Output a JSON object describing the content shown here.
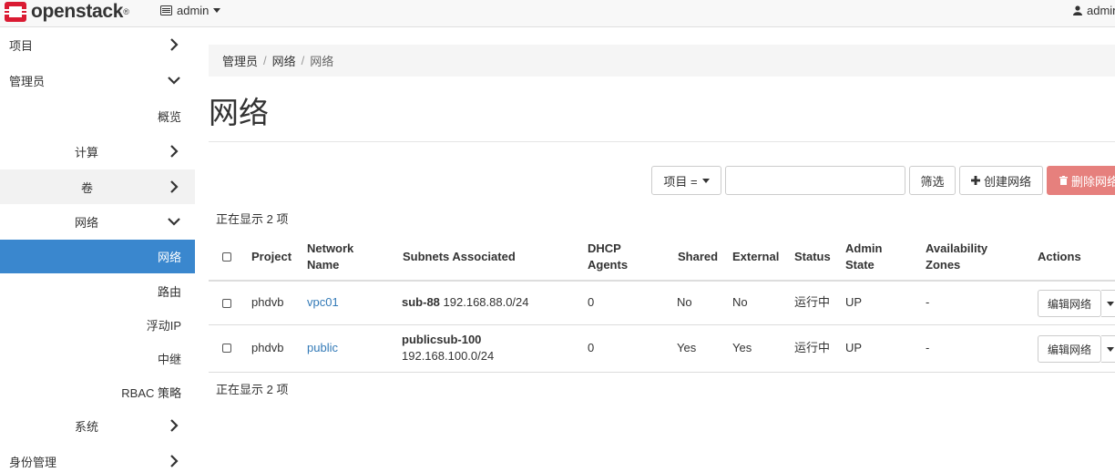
{
  "navbar": {
    "logo_text": "openstack",
    "logo_mark": "®",
    "project_label": "admin",
    "user_label": "admin"
  },
  "sidebar": {
    "items": [
      {
        "label": "项目"
      },
      {
        "label": "管理员"
      },
      {
        "label": "概览"
      },
      {
        "label": "计算"
      },
      {
        "label": "卷"
      },
      {
        "label": "网络"
      },
      {
        "label": "网络"
      },
      {
        "label": "路由"
      },
      {
        "label": "浮动IP"
      },
      {
        "label": "中继"
      },
      {
        "label": "RBAC 策略"
      },
      {
        "label": "系统"
      },
      {
        "label": "身份管理"
      }
    ]
  },
  "breadcrumb": [
    "管理员",
    "网络",
    "网络"
  ],
  "page_title": "网络",
  "toolbar": {
    "filter_field": "项目 =",
    "filter_value": "",
    "filter_button": "筛选",
    "create_button": "创建网络",
    "delete_button": "删除网络"
  },
  "count_top": "正在显示 2 项",
  "count_bottom": "正在显示 2 项",
  "table": {
    "headers": {
      "project": "Project",
      "network_name_1": "Network",
      "network_name_2": "Name",
      "subnets": "Subnets Associated",
      "dhcp_1": "DHCP",
      "dhcp_2": "Agents",
      "shared": "Shared",
      "external": "External",
      "status": "Status",
      "admin_1": "Admin",
      "admin_2": "State",
      "zones_1": "Availability",
      "zones_2": "Zones",
      "actions": "Actions"
    },
    "rows": [
      {
        "project": "phdvb",
        "name": "vpc01",
        "subnet_name": "sub-88",
        "subnet_cidr": "192.168.88.0/24",
        "dhcp": "0",
        "shared": "No",
        "external": "No",
        "status": "运行中",
        "admin_state": "UP",
        "zones": "-",
        "action": "编辑网络"
      },
      {
        "project": "phdvb",
        "name": "public",
        "subnet_name": "publicsub-100",
        "subnet_cidr": "192.168.100.0/24",
        "dhcp": "0",
        "shared": "Yes",
        "external": "Yes",
        "status": "运行中",
        "admin_state": "UP",
        "zones": "-",
        "action": "编辑网络"
      }
    ]
  },
  "colors": {
    "accent": "#3a87ce",
    "danger": "#e6807d",
    "link": "#337ab7",
    "logo_red": "#da1a32"
  }
}
